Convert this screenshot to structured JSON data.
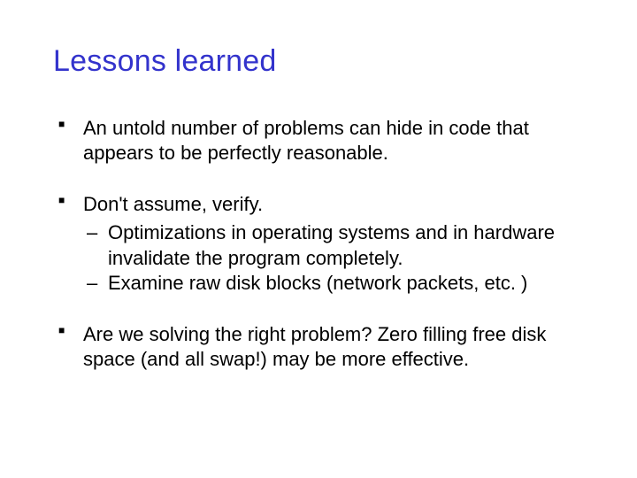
{
  "title": "Lessons learned",
  "bullets": [
    {
      "text": "An untold number of problems can hide in code that appears to be perfectly reasonable.",
      "sub": []
    },
    {
      "text": "Don't assume, verify.",
      "sub": [
        "Optimizations in operating systems and in hardware invalidate the program completely.",
        "Examine raw disk blocks (network packets, etc. )"
      ]
    },
    {
      "text": "Are we solving the right problem? Zero filling free disk space (and all swap!) may be more effective.",
      "sub": []
    }
  ]
}
